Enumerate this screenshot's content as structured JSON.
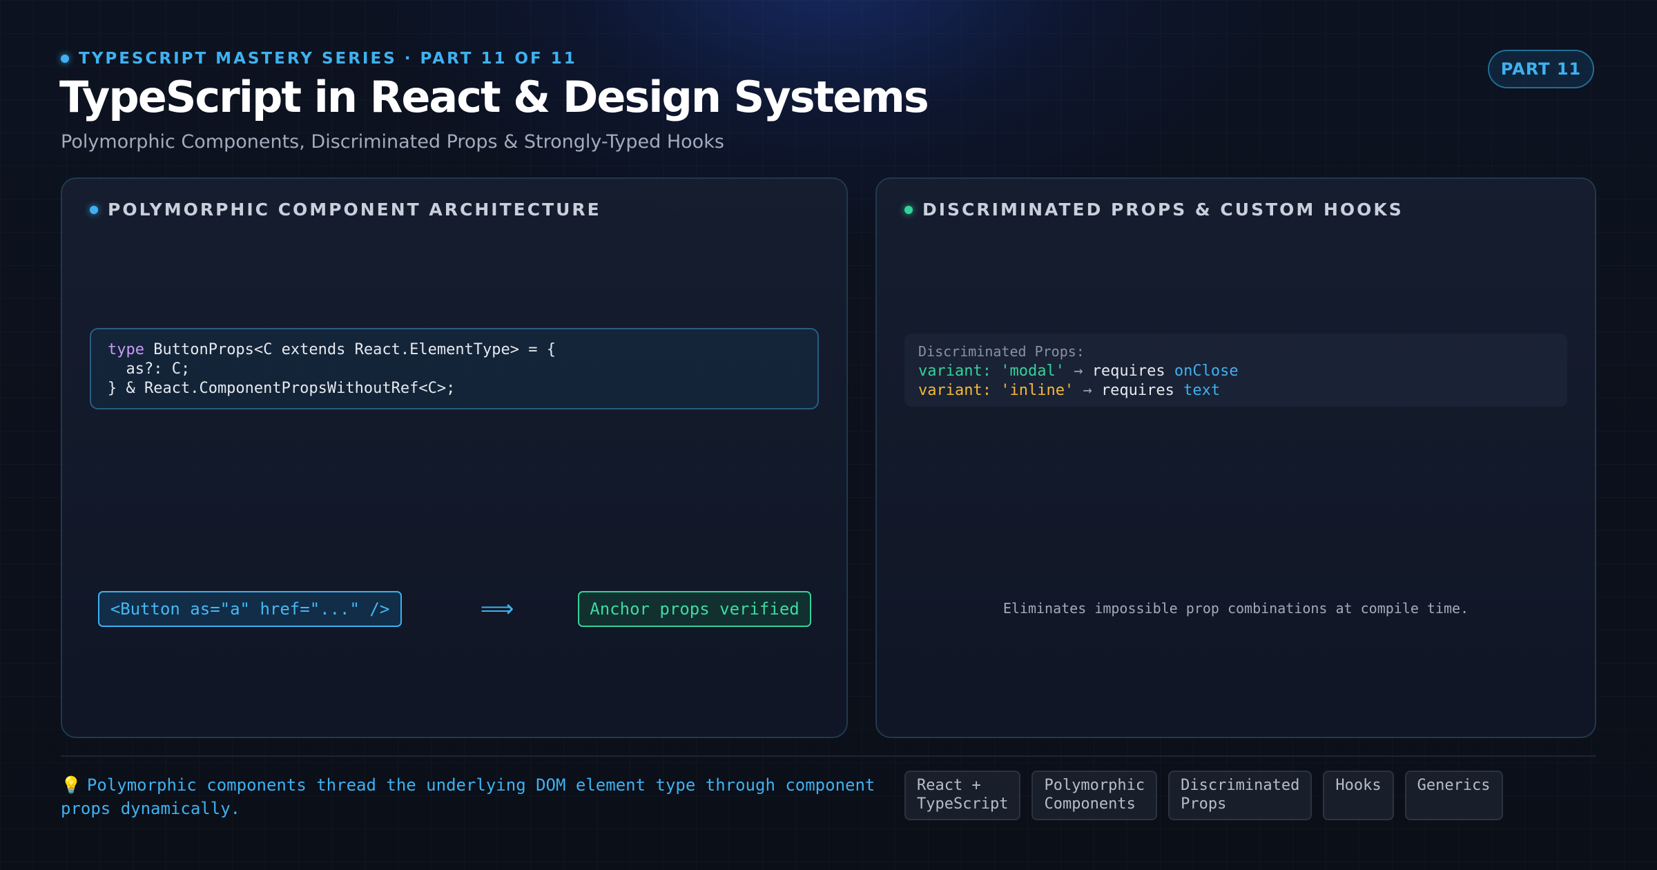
{
  "header": {
    "eyebrow": "TYPESCRIPT MASTERY SERIES · PART 11 OF 11",
    "title": "TypeScript in React & Design Systems",
    "subtitle": "Polymorphic Components, Discriminated Props & Strongly-Typed Hooks",
    "badge": "PART 11"
  },
  "left_panel": {
    "heading": "POLYMORPHIC COMPONENT ARCHITECTURE",
    "code": {
      "keyword": "type",
      "line1_rest": " ButtonProps<C extends React.ElementType> = {",
      "line2": "  as?: C;",
      "line3": "} & React.ComponentPropsWithoutRef<C>;"
    },
    "input_chip": "<Button as=\"a\" href=\"...\" />",
    "arrow": "⟹",
    "result_chip": "Anchor props verified"
  },
  "right_panel": {
    "heading": "DISCRIMINATED PROPS & CUSTOM HOOKS",
    "box_title": "Discriminated Props:",
    "rows": [
      {
        "key": "variant:",
        "value": "'modal'",
        "arrow": "→",
        "text": "requires",
        "prop": "onClose"
      },
      {
        "key": "variant:",
        "value": "'inline'",
        "arrow": "→",
        "text": "requires",
        "prop": "text"
      }
    ],
    "note": "Eliminates impossible prop combinations at compile time."
  },
  "footer": {
    "tip_icon": "💡",
    "tip": "Polymorphic components thread the underlying DOM element type through component props dynamically.",
    "tags": [
      {
        "line1": "React +",
        "line2": "TypeScript"
      },
      {
        "line1": "Polymorphic",
        "line2": "Components"
      },
      {
        "line1": "Discriminated",
        "line2": "Props"
      },
      {
        "line1": "Hooks",
        "line2": ""
      },
      {
        "line1": "Generics",
        "line2": ""
      }
    ]
  },
  "colors": {
    "accent_blue": "#3fb1f0",
    "accent_green": "#34d399",
    "accent_yellow": "#f5b93a",
    "keyword_purple": "#c89bf5"
  }
}
